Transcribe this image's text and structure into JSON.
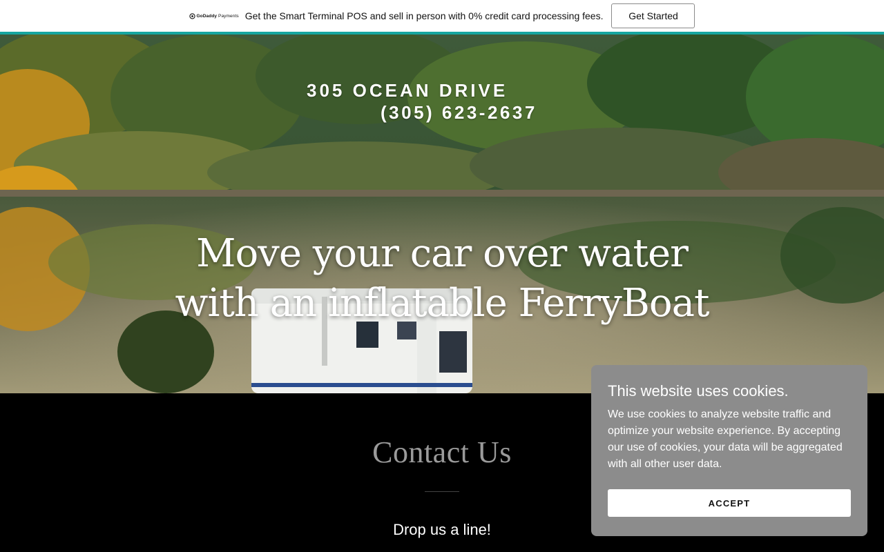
{
  "promo": {
    "brand_bold": "GoDaddy",
    "brand_light": "Payments",
    "text": "Get the Smart Terminal POS and sell in person with 0% credit card processing fees.",
    "cta": "Get Started"
  },
  "hero": {
    "address": "305 OCEAN DRIVE",
    "phone": "(305) 623-2637",
    "headline_line1": "Move your car over water",
    "headline_line2": "with an inflatable FerryBoat"
  },
  "contact": {
    "title": "Contact Us",
    "subtitle": "Drop us a line!"
  },
  "cookie": {
    "title": "This website uses cookies.",
    "body": "We use cookies to analyze website traffic and optimize your website experience. By accepting our use of cookies, your data will be aggregated with all other user data.",
    "accept": "ACCEPT"
  },
  "colors": {
    "accent_teal": "#16a6a0",
    "cookie_bg": "#8c8c8c",
    "contact_title": "#9a9a9a"
  }
}
